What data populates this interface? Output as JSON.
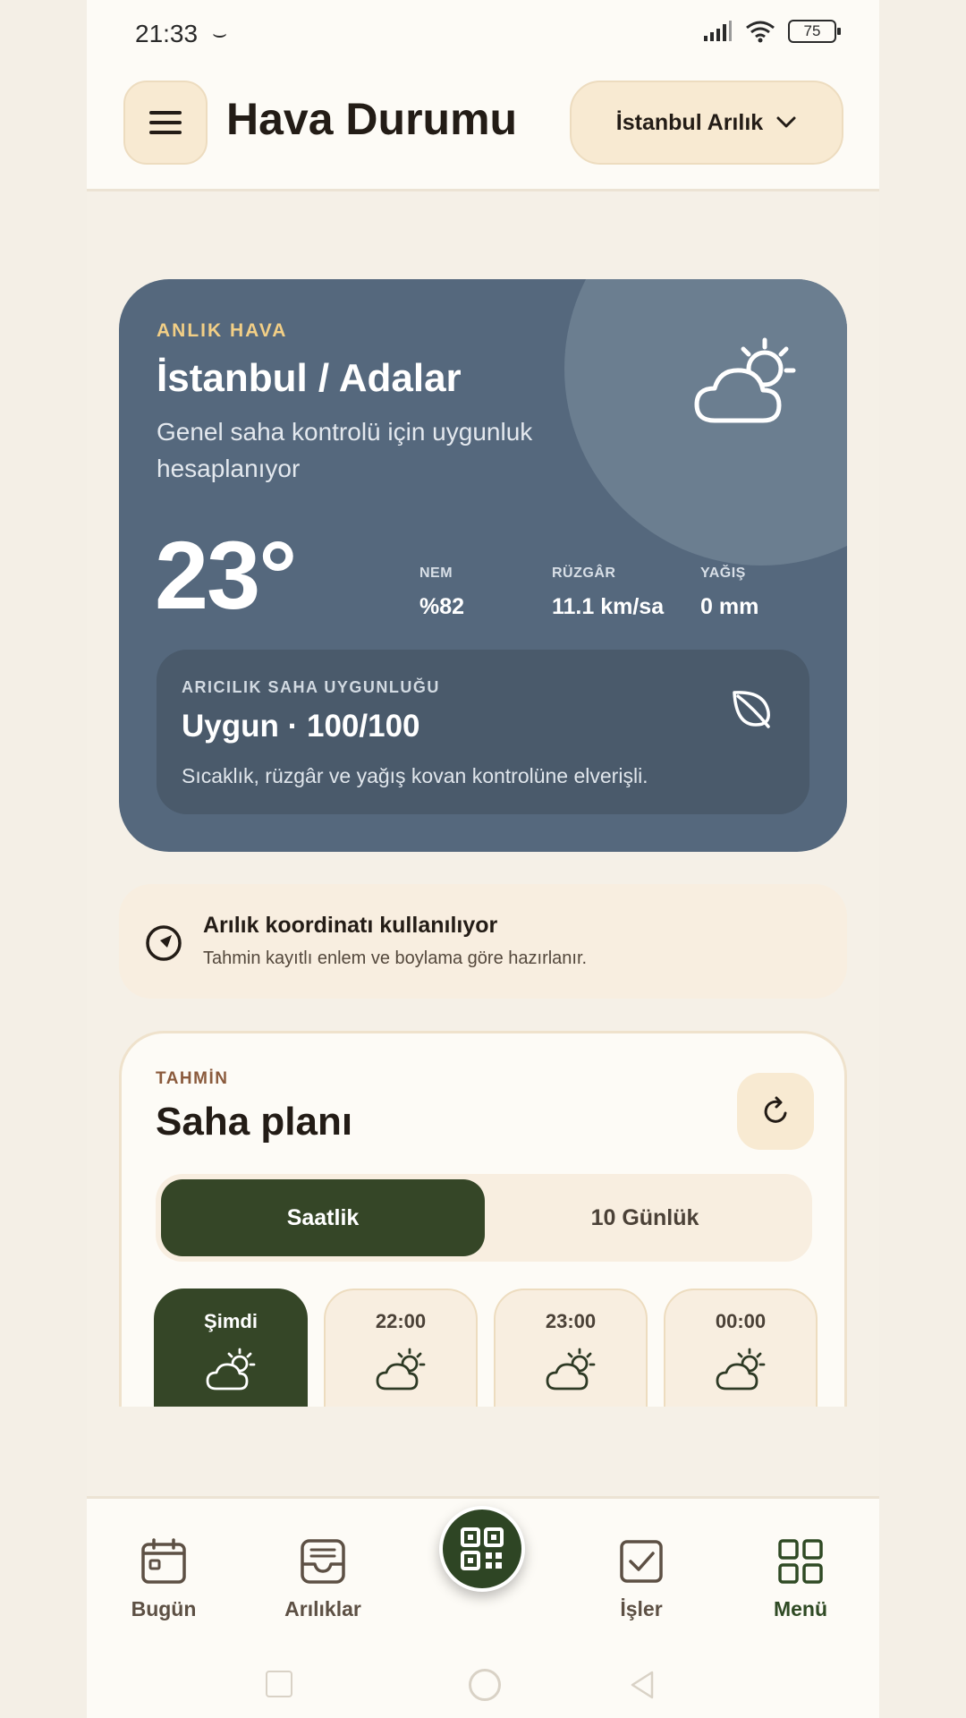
{
  "status_bar": {
    "time": "21:33",
    "extra": "⌣",
    "battery": "75"
  },
  "header": {
    "title": "Hava Durumu",
    "location": "İstanbul Arılık"
  },
  "current": {
    "kicker": "ANLIK HAVA",
    "city": "İstanbul / Adalar",
    "description": "Genel saha kontrolü için uygunluk hesaplanıyor",
    "temperature": "23°",
    "metrics": [
      {
        "label": "NEM",
        "value": "%82"
      },
      {
        "label": "RÜZGÂR",
        "value": "11.1 km/sa"
      },
      {
        "label": "YAĞIŞ",
        "value": "0 mm"
      }
    ],
    "suitability": {
      "kicker": "ARICILIK SAHA UYGUNLUĞU",
      "value": "Uygun · 100/100",
      "description": "Sıcaklık, rüzgâr ve yağış kovan kontrolüne elverişli."
    }
  },
  "coordinate": {
    "title": "Arılık koordinatı kullanılıyor",
    "subtitle": "Tahmin kayıtlı enlem ve boylama göre hazırlanır."
  },
  "forecast": {
    "kicker": "TAHMİN",
    "title": "Saha planı",
    "tabs": [
      {
        "label": "Saatlik",
        "active": true
      },
      {
        "label": "10 Günlük",
        "active": false
      }
    ],
    "hours": [
      {
        "label": "Şimdi",
        "icon": "partly-cloudy-icon",
        "active": true
      },
      {
        "label": "22:00",
        "icon": "partly-cloudy-icon",
        "active": false
      },
      {
        "label": "23:00",
        "icon": "partly-cloudy-icon",
        "active": false
      },
      {
        "label": "00:00",
        "icon": "partly-cloudy-icon",
        "active": false
      }
    ]
  },
  "bottom_nav": {
    "items": [
      {
        "label": "Bugün",
        "icon": "calendar-icon"
      },
      {
        "label": "Arılıklar",
        "icon": "inbox-icon"
      },
      {
        "label": "İşler",
        "icon": "checkbox-icon"
      },
      {
        "label": "Menü",
        "icon": "grid-icon"
      }
    ],
    "center_icon": "qr-code-icon"
  },
  "colors": {
    "hero_bg": "#55687d",
    "accent_green": "#354627",
    "kicker_gold": "#f2cf86",
    "cream": "#f8ead2"
  }
}
